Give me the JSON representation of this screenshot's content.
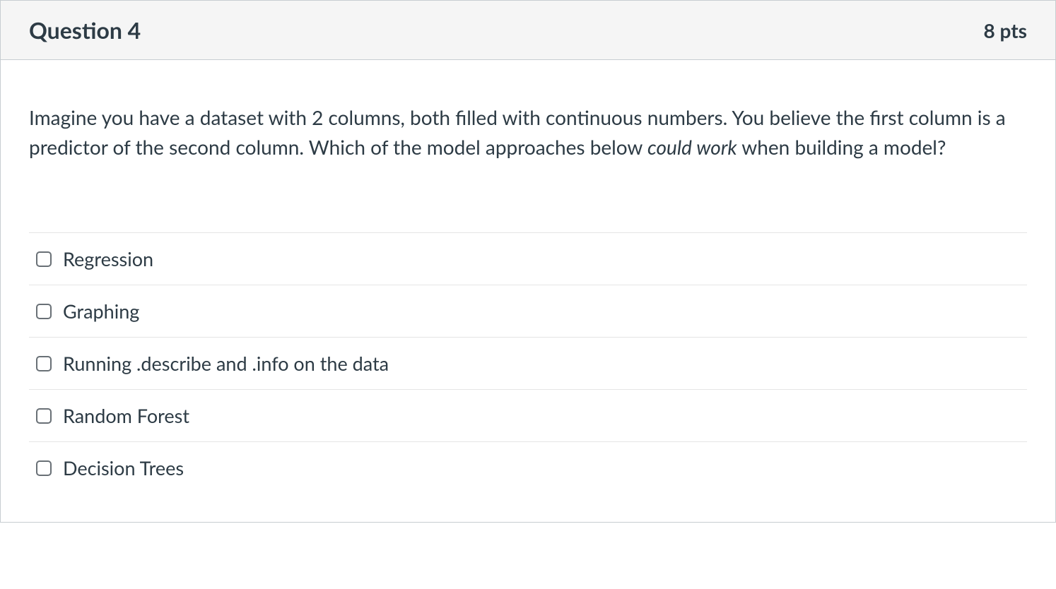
{
  "header": {
    "title": "Question 4",
    "points": "8 pts"
  },
  "prompt": {
    "text_before_em": "Imagine you have a dataset with 2 columns, both filled with continuous numbers. You believe the first column is a predictor of the second column. Which of the model approaches below ",
    "em_text": "could work",
    "text_after_em": " when building a model?"
  },
  "answers": [
    {
      "label": "Regression"
    },
    {
      "label": "Graphing"
    },
    {
      "label": "Running .describe and .info on the data"
    },
    {
      "label": "Random Forest"
    },
    {
      "label": "Decision Trees"
    }
  ]
}
